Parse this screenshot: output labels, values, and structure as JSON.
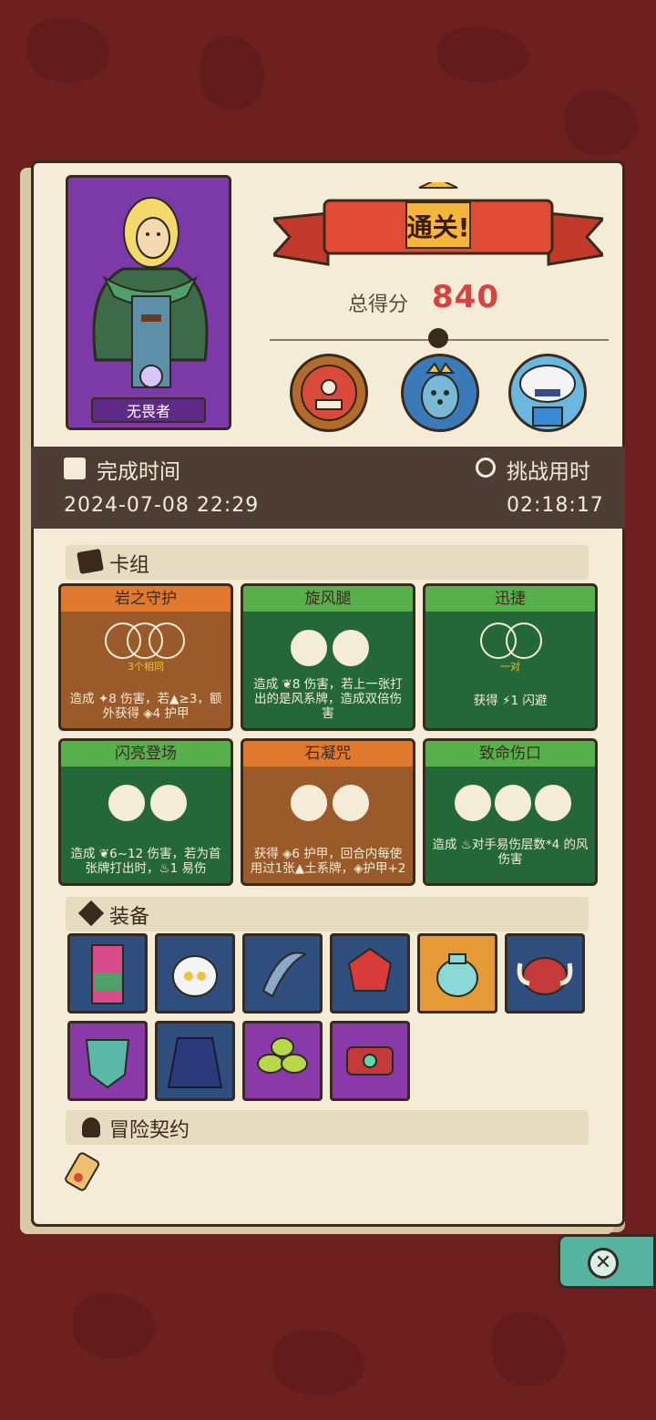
{
  "header": {
    "hero_name": "无畏者",
    "banner": "通关!",
    "score_label": "总得分",
    "score_value": "840"
  },
  "times": {
    "finish_label": "完成时间",
    "finish_value": "2024-07-08 22:29",
    "duration_label": "挑战用时",
    "duration_value": "02:18:17"
  },
  "sections": {
    "deck": "卡组",
    "equipment": "装备",
    "contract": "冒险契约"
  },
  "cards": [
    {
      "name": "岩之守护",
      "color": "brown",
      "sub": "3个相同",
      "desc": "造成 ✦8 伤害，若▲≥3，额外获得 ◈4 护甲"
    },
    {
      "name": "旋风腿",
      "color": "green",
      "sub": "",
      "desc": "造成 ❦8 伤害，若上一张打出的是风系牌，造成双倍伤害"
    },
    {
      "name": "迅捷",
      "color": "green",
      "sub": "一对",
      "desc": "获得 ⚡1 闪避"
    },
    {
      "name": "闪亮登场",
      "color": "green",
      "sub": "",
      "desc": "造成 ❦6~12 伤害，若为首张牌打出时，♨1 易伤"
    },
    {
      "name": "石凝咒",
      "color": "brown",
      "sub": "",
      "desc": "获得 ◈6 护甲，回合内每使用过1张▲土系牌，◈护甲+2"
    },
    {
      "name": "致命伤口",
      "color": "green",
      "sub": "",
      "desc": "造成 ♨对手易伤层数*4 的风伤害"
    }
  ],
  "equipment_icons": [
    "totem-icon",
    "skull-helmet-icon",
    "scythe-icon",
    "ruby-gem-icon",
    "vase-icon",
    "horn-meat-icon",
    "demon-shield-icon",
    "blue-cloak-icon",
    "leaf-icon",
    "bracer-icon"
  ],
  "colors": {
    "background": "#6e1f1f",
    "paper": "#f4ecd6",
    "score": "#d94040",
    "brown_card": "#9a5a2a",
    "green_card": "#24683a"
  }
}
